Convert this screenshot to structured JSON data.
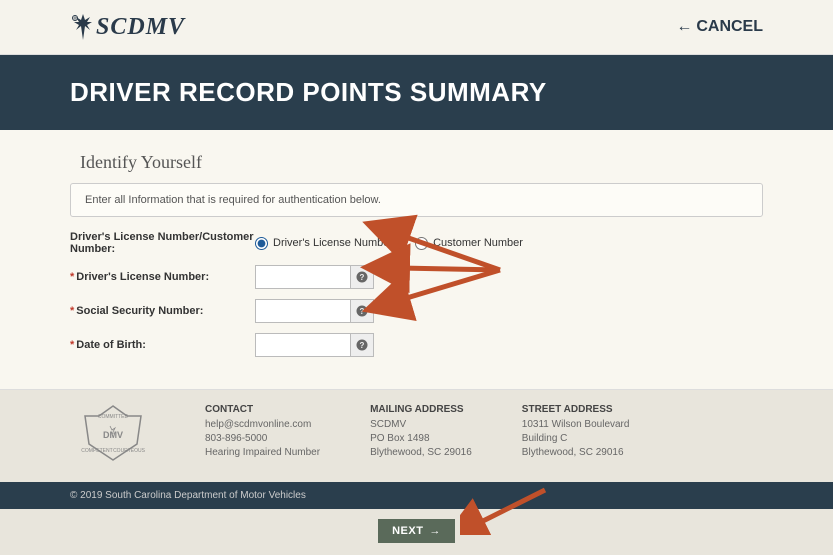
{
  "header": {
    "brand": "SCDMV",
    "cancel": "CANCEL"
  },
  "title": "DRIVER RECORD POINTS SUMMARY",
  "section": {
    "heading": "Identify Yourself",
    "intro": "Enter all Information that is required for authentication below."
  },
  "form": {
    "radio_label": "Driver's License Number/Customer Number:",
    "radio_opts": {
      "dln": "Driver's License Number",
      "cust": "Customer Number"
    },
    "fields": {
      "dln": {
        "label": "Driver's License Number:",
        "value": ""
      },
      "ssn": {
        "label": "Social Security Number:",
        "value": ""
      },
      "dob": {
        "label": "Date of Birth:",
        "value": ""
      }
    }
  },
  "footer": {
    "contact": {
      "h": "CONTACT",
      "email": "help@scdmvonline.com",
      "phone": "803-896-5000",
      "hearing": "Hearing Impaired Number"
    },
    "mailing": {
      "h": "MAILING ADDRESS",
      "l1": "SCDMV",
      "l2": "PO Box 1498",
      "l3": "Blythewood, SC 29016"
    },
    "street": {
      "h": "STREET ADDRESS",
      "l1": "10311 Wilson Boulevard",
      "l2": "Building C",
      "l3": "Blythewood, SC 29016"
    }
  },
  "copyright": "© 2019 South Carolina Department of Motor Vehicles",
  "next": "NEXT"
}
